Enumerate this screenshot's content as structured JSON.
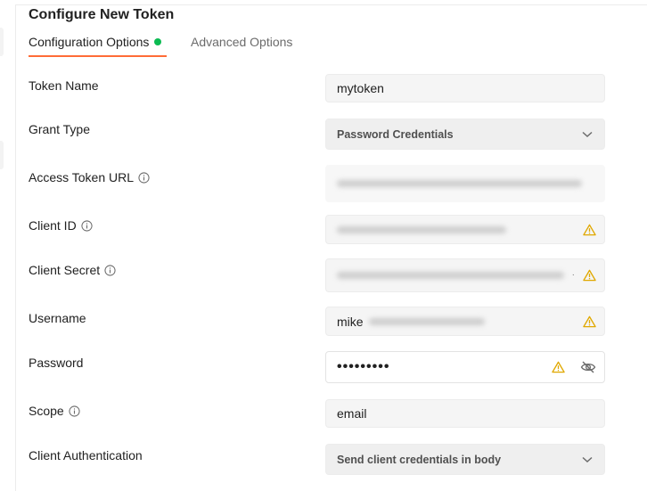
{
  "panel": {
    "title": "Configure New Token"
  },
  "tabs": [
    {
      "label": "Configuration Options",
      "active": true,
      "status": "green-dot"
    },
    {
      "label": "Advanced Options",
      "active": false
    }
  ],
  "form": {
    "token_name": {
      "label": "Token Name",
      "value": "mytoken"
    },
    "grant_type": {
      "label": "Grant Type",
      "value": "Password Credentials"
    },
    "access_token_url": {
      "label": "Access Token URL",
      "value": ""
    },
    "client_id": {
      "label": "Client ID",
      "value": ""
    },
    "client_secret": {
      "label": "Client Secret",
      "value": ""
    },
    "username": {
      "label": "Username",
      "value": "mike"
    },
    "password": {
      "label": "Password",
      "value": "•••••••••"
    },
    "scope": {
      "label": "Scope",
      "value": "email"
    },
    "client_authentication": {
      "label": "Client Authentication",
      "value": "Send client credentials in body"
    }
  },
  "colors": {
    "accent": "#ff6c37",
    "status_green": "#0cbb52",
    "warning": "#e0a800"
  },
  "icons": [
    "info-icon",
    "warning-icon",
    "chevron-down-icon",
    "eye-slash-icon"
  ]
}
